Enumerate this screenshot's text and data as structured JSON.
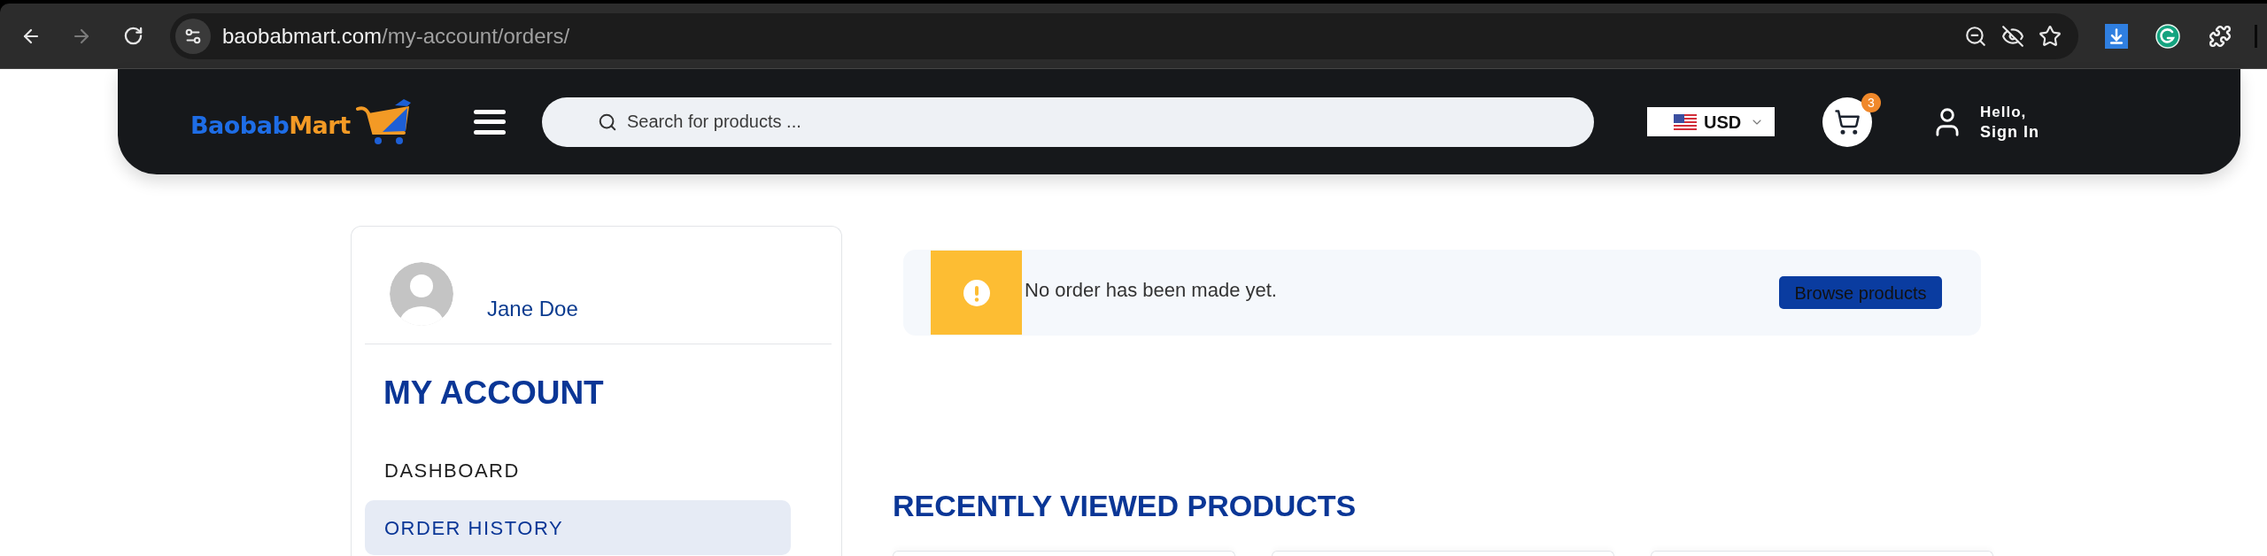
{
  "browser": {
    "forward_disabled": true,
    "url": {
      "host": "baobabmart.com",
      "path": "/my-account/orders/"
    }
  },
  "header": {
    "logo": {
      "first": "Baobab",
      "second": "Mart"
    },
    "search": {
      "placeholder": "Search for products ..."
    },
    "currency": {
      "code": "USD"
    },
    "cart": {
      "count": "3"
    },
    "account": {
      "greeting": "Hello,",
      "action": "Sign In"
    }
  },
  "sidebar": {
    "user_name": "Jane Doe",
    "title": "MY ACCOUNT",
    "items": [
      {
        "label": "DASHBOARD",
        "selected": false
      },
      {
        "label": "ORDER HISTORY",
        "selected": true
      }
    ]
  },
  "notice": {
    "message": "No order has been made yet.",
    "button": "Browse products"
  },
  "recently_viewed": {
    "title": "RECENTLY VIEWED PRODUCTS"
  }
}
